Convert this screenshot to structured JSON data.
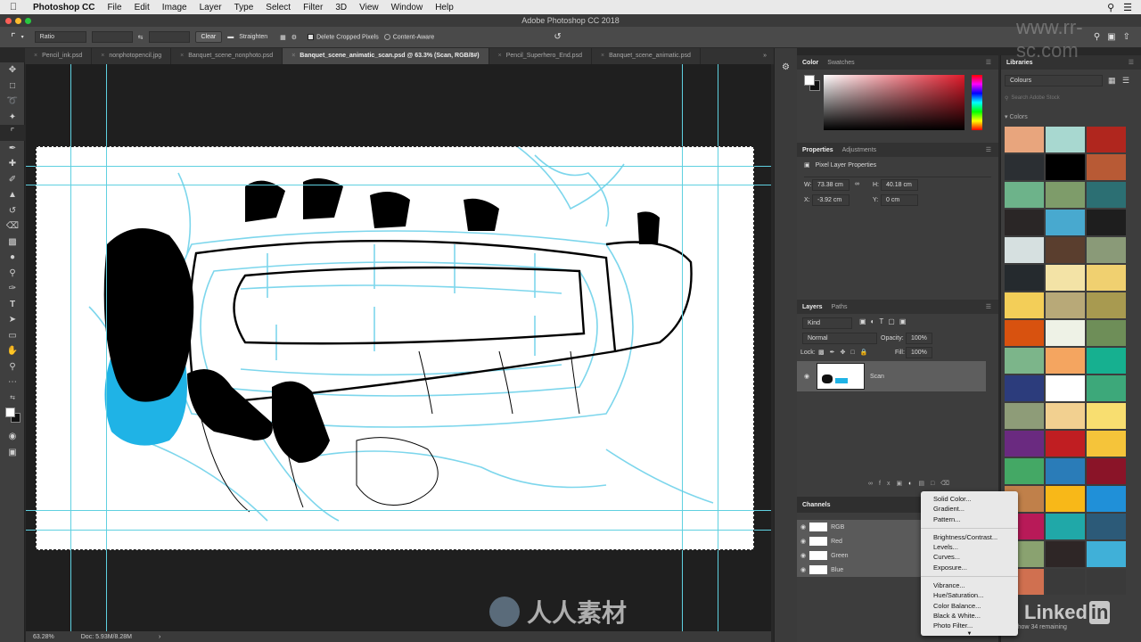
{
  "menubar": {
    "app_name": "Photoshop CC",
    "items": [
      "File",
      "Edit",
      "Image",
      "Layer",
      "Type",
      "Select",
      "Filter",
      "3D",
      "View",
      "Window",
      "Help"
    ]
  },
  "window_title": "Adobe Photoshop CC 2018",
  "options_bar": {
    "ratio_label": "Ratio",
    "clear_label": "Clear",
    "straighten_label": "Straighten",
    "delete_cropped_label": "Delete Cropped Pixels",
    "content_aware_label": "Content-Aware"
  },
  "tabs": [
    {
      "label": "Pencil_ink.psd",
      "active": false
    },
    {
      "label": "nonphotopencil.jpg",
      "active": false
    },
    {
      "label": "Banquet_scene_nonphoto.psd",
      "active": false
    },
    {
      "label": "Banquet_scene_animatic_scan.psd @ 63.3% (Scan, RGB/8#)",
      "active": true
    },
    {
      "label": "Pencil_Superhero_End.psd",
      "active": false
    },
    {
      "label": "Banquet_scene_animatic.psd",
      "active": false
    }
  ],
  "status": {
    "zoom": "63.28%",
    "doc": "Doc: 5.93M/8.28M"
  },
  "color_panel": {
    "tabs": [
      "Color",
      "Swatches"
    ],
    "foreground": "#ffffff",
    "background": "#111111"
  },
  "properties_panel": {
    "tabs": [
      "Properties",
      "Adjustments"
    ],
    "subtitle": "Pixel Layer Properties",
    "w_label": "W:",
    "w_value": "73.38 cm",
    "h_label": "H:",
    "h_value": "40.18 cm",
    "x_label": "X:",
    "x_value": "-3.92 cm",
    "y_label": "Y:",
    "y_value": "0 cm"
  },
  "layers_panel": {
    "tabs": [
      "Layers",
      "Paths"
    ],
    "kind_label": "Kind",
    "blend_mode": "Normal",
    "opacity_label": "Opacity:",
    "opacity_value": "100%",
    "lock_label": "Lock:",
    "fill_label": "Fill:",
    "fill_value": "100%",
    "layers": [
      {
        "name": "Scan",
        "visible": true
      }
    ]
  },
  "channels_panel": {
    "title": "Channels",
    "channels": [
      "RGB",
      "Red",
      "Green",
      "Blue"
    ]
  },
  "libraries_panel": {
    "title": "Libraries",
    "library_name": "Colours",
    "search_placeholder": "Search Adobe Stock",
    "section_label": "Colors",
    "footer_text": "Show 34 remaining",
    "swatches": [
      "#e8a57d",
      "#a8d8d0",
      "#b0261e",
      "#2b2f33",
      "#000000",
      "#b85a35",
      "#6db38a",
      "#7e9c6a",
      "#2c6f73",
      "#2a2626",
      "#48a9cf",
      "#1e1e1e",
      "#d6e0e0",
      "#5a3e2e",
      "#8a9a78",
      "#252a2e",
      "#f3e3a6",
      "#f0d070",
      "#f3ce58",
      "#b8a978",
      "#a89a50",
      "#d8520f",
      "#eef2e6",
      "#6e8e58",
      "#7cb58a",
      "#f4a560",
      "#16b090",
      "#2c3c7c",
      "#ffffff",
      "#3da87a",
      "#8e9c78",
      "#f2d090",
      "#f8de70",
      "#6a2a80",
      "#c01e22",
      "#f5c43a",
      "#44a865",
      "#2a7cb8",
      "#8a1428",
      "#c0804a",
      "#f8b818",
      "#2090d8",
      "#b81a58",
      "#20a8a8",
      "#2c5a78",
      "#8aa270",
      "#2e2626",
      "#40b0d8",
      "#d07050",
      "#3a3a3a",
      "#3a3a3a"
    ]
  },
  "context_menu": {
    "group1": [
      "Solid Color...",
      "Gradient...",
      "Pattern..."
    ],
    "group2": [
      "Brightness/Contrast...",
      "Levels...",
      "Curves...",
      "Exposure..."
    ],
    "group3": [
      "Vibrance...",
      "Hue/Saturation...",
      "Color Balance...",
      "Black & White...",
      "Photo Filter..."
    ]
  },
  "branding": {
    "linkedin": "Linked",
    "linkedin_in": "in",
    "rr_text": "人人素材",
    "rr_url": "www.rr-sc.com"
  }
}
